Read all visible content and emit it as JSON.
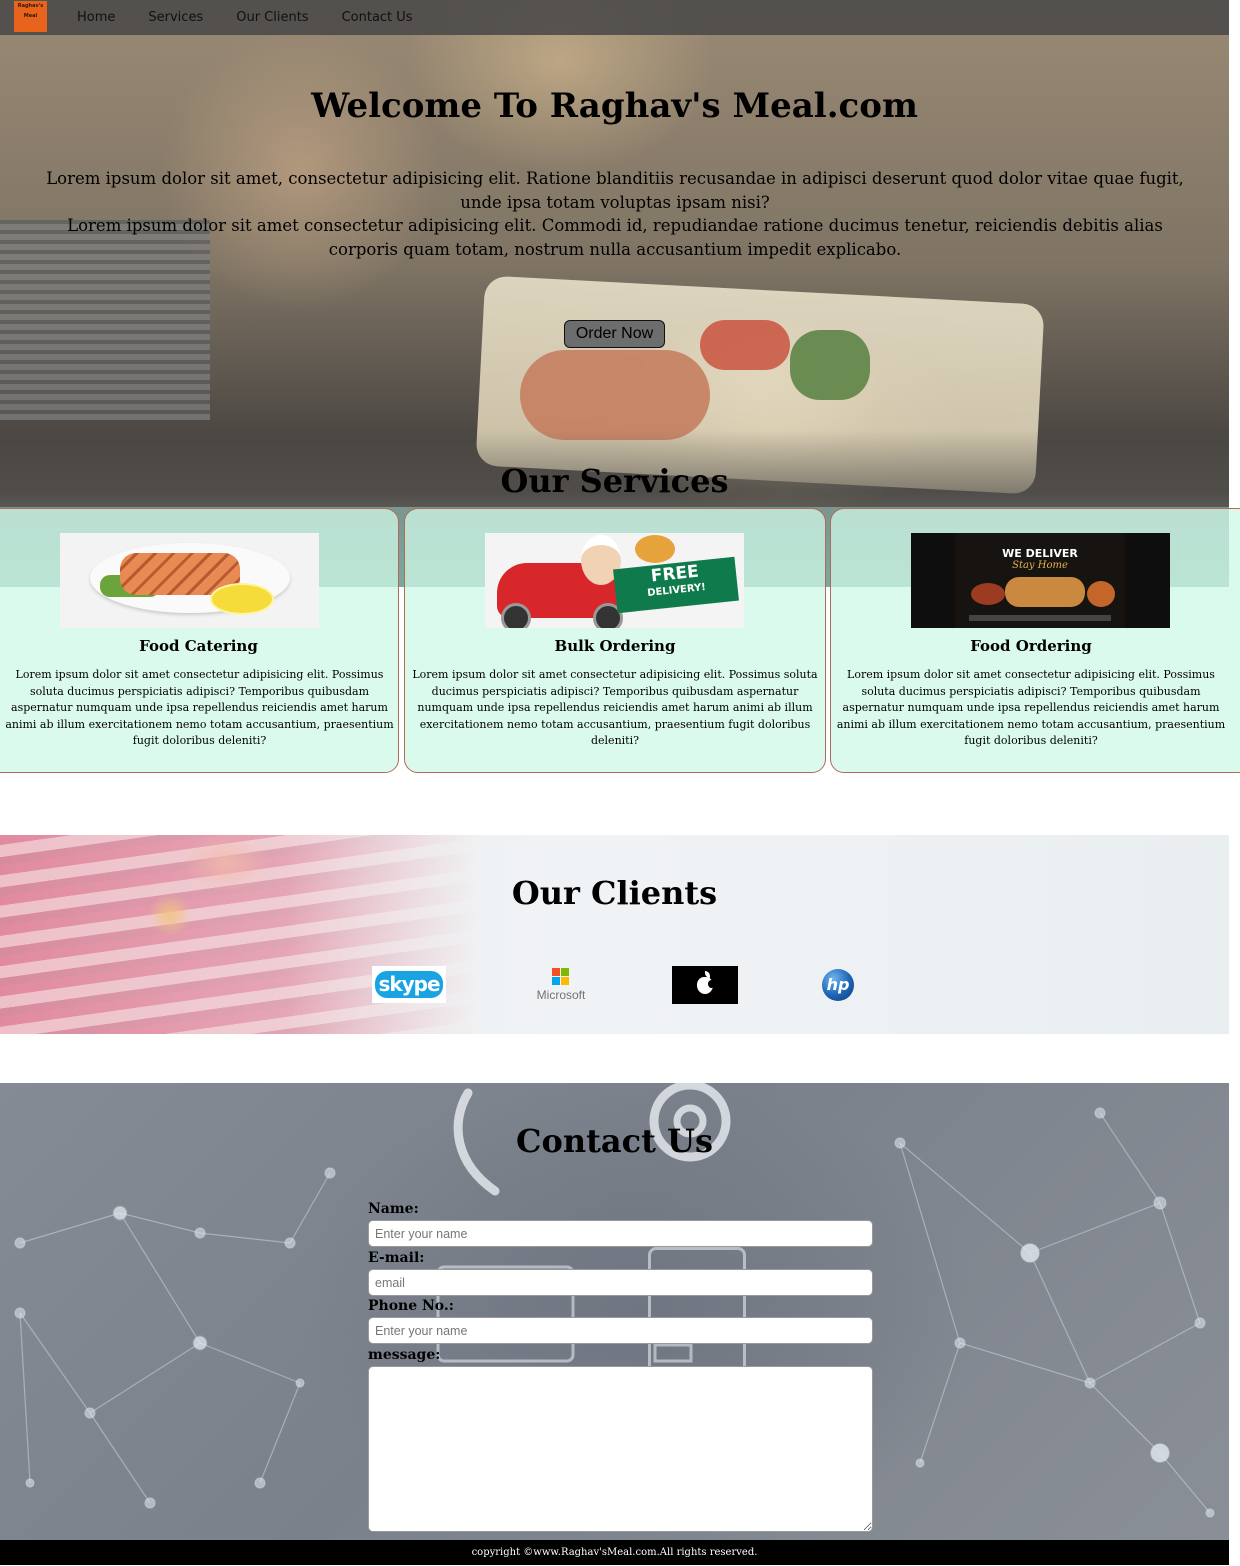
{
  "nav": {
    "logo_text": "Raghav's Meal",
    "links": [
      "Home",
      "Services",
      "Our Clients",
      "Contact Us"
    ]
  },
  "hero": {
    "title": "Welcome To Raghav's Meal.com",
    "paragraph1": "Lorem ipsum dolor sit amet, consectetur adipisicing elit. Ratione blanditiis recusandae in adipisci deserunt quod dolor vitae quae fugit, unde ipsa totam voluptas ipsam nisi?",
    "paragraph2": "Lorem ipsum dolor sit amet consectetur adipisicing elit. Commodi id, repudiandae ratione ducimus tenetur, reiciendis debitis alias corporis quam totam, nostrum nulla accusantium impedit explicabo.",
    "order_button": "Order Now"
  },
  "services": {
    "title": "Our Services",
    "cards": [
      {
        "title": "Food Catering",
        "text": "Lorem ipsum dolor sit amet consectetur adipisicing elit. Possimus soluta ducimus perspiciatis adipisci? Temporibus quibusdam aspernatur numquam unde ipsa repellendus reiciendis amet harum animi ab illum exercitationem nemo totam accusantium, praesentium fugit doloribus deleniti?"
      },
      {
        "title": "Bulk Ordering",
        "text": "Lorem ipsum dolor sit amet consectetur adipisicing elit. Possimus soluta ducimus perspiciatis adipisci? Temporibus quibusdam aspernatur numquam unde ipsa repellendus reiciendis amet harum animi ab illum exercitationem nemo totam accusantium, praesentium fugit doloribus deleniti?"
      },
      {
        "title": "Food Ordering",
        "text": "Lorem ipsum dolor sit amet consectetur adipisicing elit. Possimus soluta ducimus perspiciatis adipisci? Temporibus quibusdam aspernatur numquam unde ipsa repellendus reiciendis amet harum animi ab illum exercitationem nemo totam accusantium, praesentium fugit doloribus deleniti?"
      }
    ],
    "images": {
      "delivery_banner": "FREE",
      "delivery_banner_sub": "DELIVERY!",
      "ordering_heading": "WE DELIVER",
      "ordering_subheading": "Stay Home"
    }
  },
  "clients": {
    "title": "Our Clients",
    "logos": {
      "skype": "skype",
      "microsoft": "Microsoft",
      "apple": "apple",
      "hp": "hp"
    },
    "microsoft_colors": [
      "#f25022",
      "#7fba00",
      "#00a4ef",
      "#ffb900"
    ]
  },
  "contact": {
    "title": "Contact Us",
    "name_label": "Name:",
    "name_placeholder": "Enter your name",
    "email_label": "E-mail:",
    "email_placeholder": "email",
    "phone_label": "Phone No.:",
    "phone_placeholder": "Enter your name",
    "message_label": "message:"
  },
  "footer": {
    "text": "copyright ©www.Raghav'sMeal.com.All rights reserved."
  },
  "colors": {
    "nav_bg": "#464646",
    "card_bg": "#cff8e8",
    "card_border": "#b06a5a",
    "logo_bg": "#e8641c",
    "footer_bg": "#000000"
  }
}
